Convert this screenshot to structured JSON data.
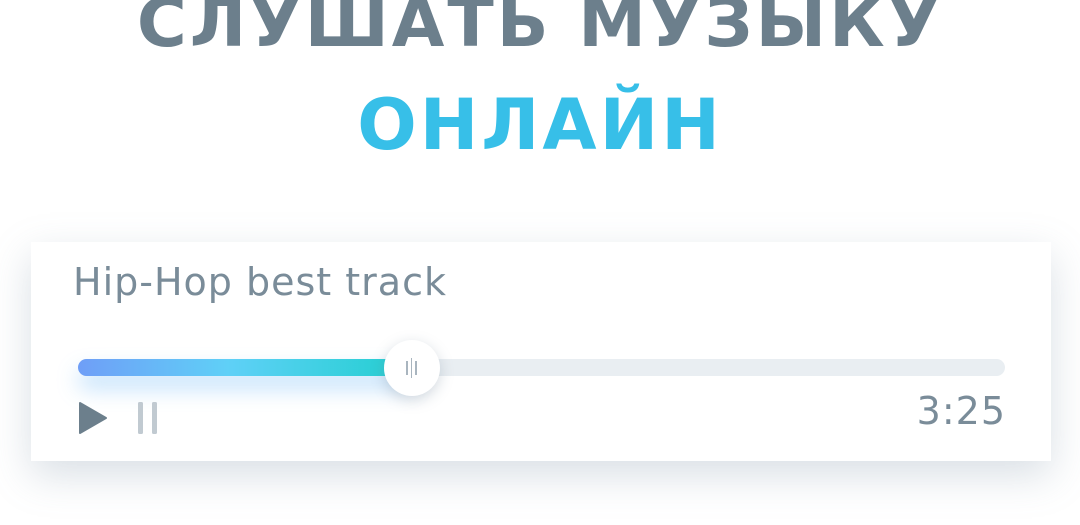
{
  "hero": {
    "line1": "СЛУШАТЬ МУЗЫКУ",
    "line2": "ОНЛАЙН"
  },
  "player": {
    "track_title": "Hip-Hop best track",
    "duration": "3:25",
    "progress_fraction": 0.36,
    "controls": {
      "play_icon": "play-icon",
      "pause_icon": "pause-icon",
      "thumb_icon": "grip-lines-icon"
    }
  },
  "colors": {
    "heading": "#6c7f8c",
    "accent": "#37bfe8",
    "progress_start": "#6f9ef7",
    "progress_end": "#21cfcf",
    "track_bg": "#e9eef2",
    "text": "#7a8c99",
    "icon": "#6c7f8c"
  }
}
